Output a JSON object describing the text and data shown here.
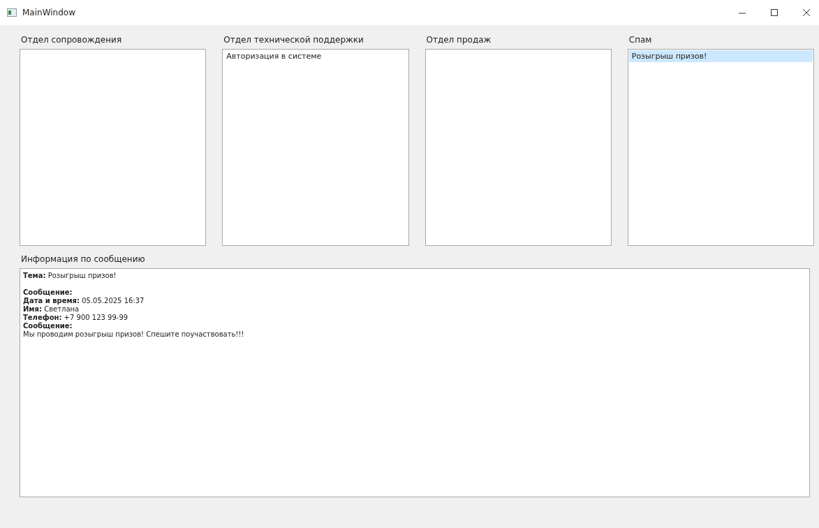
{
  "window": {
    "title": "MainWindow"
  },
  "departments": [
    {
      "title": "Отдел сопровождения"
    },
    {
      "title": "Отдел технической поддержки",
      "items": [
        {
          "text": "Авторизация в системе",
          "selected": false
        }
      ]
    },
    {
      "title": "Отдел продаж"
    },
    {
      "title": "Спам",
      "items": [
        {
          "text": "Розыгрыш призов!",
          "selected": true
        }
      ]
    }
  ],
  "info": {
    "title": "Информация по сообщению",
    "paragraphs": [
      [
        "**Тема:** Розыгрыш призов!"
      ],
      [
        "**Сообщение:**",
        "**Дата и время:** 05.05.2025 16:37",
        "**Имя:** Светлана",
        "**Телефон:** +7 900 123 99-99",
        "**Сообщение:**",
        "Мы проводим розыгрыш призов! Спешите поучаствовать!!!"
      ]
    ]
  }
}
